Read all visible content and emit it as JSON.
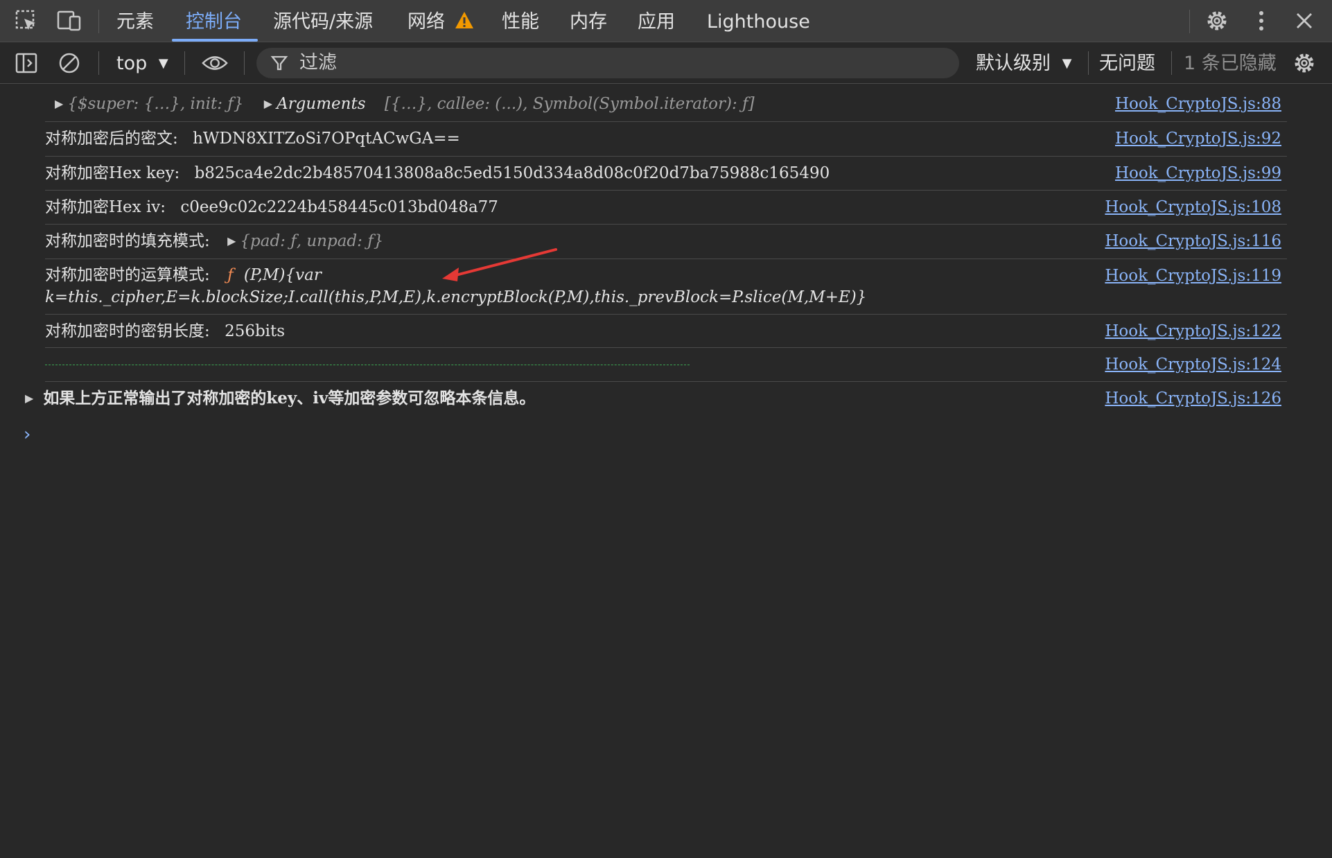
{
  "tabs": {
    "items": [
      "元素",
      "控制台",
      "源代码/来源",
      "网络",
      "性能",
      "内存",
      "应用",
      "Lighthouse"
    ],
    "active": "控制台"
  },
  "toolbar": {
    "context": "top",
    "filter_placeholder": "过滤",
    "level": "默认级别",
    "issues": "无问题",
    "hidden": "1 条已隐藏"
  },
  "console": {
    "rows": [
      {
        "parts": {
          "p1": "{$super: {…}, init: ƒ}",
          "p2": "Arguments",
          "p3": "[{…}, callee: (...), Symbol(Symbol.iterator): ƒ]"
        },
        "source": "Hook_CryptoJS.js:88"
      },
      {
        "label": "对称加密后的密文:",
        "value": "hWDN8XITZoSi7OPqtACwGA==",
        "source": "Hook_CryptoJS.js:92"
      },
      {
        "label": "对称加密Hex key:",
        "value": "b825ca4e2dc2b48570413808a8c5ed5150d334a8d08c0f20d7ba75988c165490",
        "source": "Hook_CryptoJS.js:99"
      },
      {
        "label": "对称加密Hex iv:",
        "value": "c0ee9c02c2224b458445c013bd048a77",
        "source": "Hook_CryptoJS.js:108"
      },
      {
        "label": "对称加密时的填充模式:",
        "value": "{pad: ƒ, unpad: ƒ}",
        "source": "Hook_CryptoJS.js:116"
      },
      {
        "label": "对称加密时的运算模式:",
        "fn": "ƒ",
        "line1": "(P,M){var",
        "line2": "k=this._cipher,E=k.blockSize;I.call(this,P,M,E),k.encryptBlock(P,M),this._prevBlock=P.slice(M,M+E)}",
        "source": "Hook_CryptoJS.js:119"
      },
      {
        "label": "对称加密时的密钥长度:",
        "value": "256bits",
        "source": "Hook_CryptoJS.js:122"
      },
      {
        "source": "Hook_CryptoJS.js:124"
      },
      {
        "label": "如果上方正常输出了对称加密的key、iv等加密参数可忽略本条信息。",
        "source": "Hook_CryptoJS.js:126"
      }
    ]
  },
  "colors": {
    "link": "#8ab4f8",
    "active_tab": "#7cacf8",
    "warning": "#f29900",
    "function_keyword": "#f28b54",
    "annotation_arrow": "#e53935",
    "separator_dashes": "#3ca351"
  }
}
